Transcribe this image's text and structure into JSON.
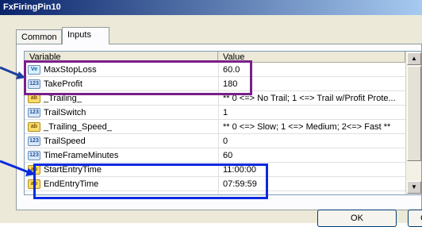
{
  "window": {
    "title": "FxFiringPin10"
  },
  "tabs": [
    {
      "label": "Common"
    },
    {
      "label": "Inputs"
    }
  ],
  "grid": {
    "headers": {
      "variable": "Variable",
      "value": "Value"
    },
    "rows": [
      {
        "icon": "Ve",
        "icon_name": "variable-icon",
        "variable": "MaxStopLoss",
        "value": "60.0"
      },
      {
        "icon": "123",
        "icon_name": "number-icon",
        "variable": "TakeProfit",
        "value": "180"
      },
      {
        "icon": "ab",
        "icon_name": "text-icon",
        "variable": "_Trailing_",
        "value": "** 0 <=> No Trail; 1 <=> Trail w/Profit Prote..."
      },
      {
        "icon": "123",
        "icon_name": "number-icon",
        "variable": "TrailSwitch",
        "value": "1"
      },
      {
        "icon": "ab",
        "icon_name": "text-icon",
        "variable": "_Trailing_Speed_",
        "value": "** 0 <=> Slow; 1 <=> Medium; 2<=> Fast **"
      },
      {
        "icon": "123",
        "icon_name": "number-icon",
        "variable": "TrailSpeed",
        "value": "0"
      },
      {
        "icon": "123",
        "icon_name": "number-icon",
        "variable": "TimeFrameMinutes",
        "value": "60"
      },
      {
        "icon": "ab",
        "icon_name": "text-icon",
        "variable": "StartEntryTime",
        "value": "11:00:00"
      },
      {
        "icon": "ab",
        "icon_name": "text-icon",
        "variable": "EndEntryTime",
        "value": "07:59:59"
      }
    ]
  },
  "buttons": {
    "ok": "OK",
    "cancel": "C"
  },
  "highlight_colors": {
    "purple": "#7a1f8a",
    "blue": "#0a2ae0"
  }
}
